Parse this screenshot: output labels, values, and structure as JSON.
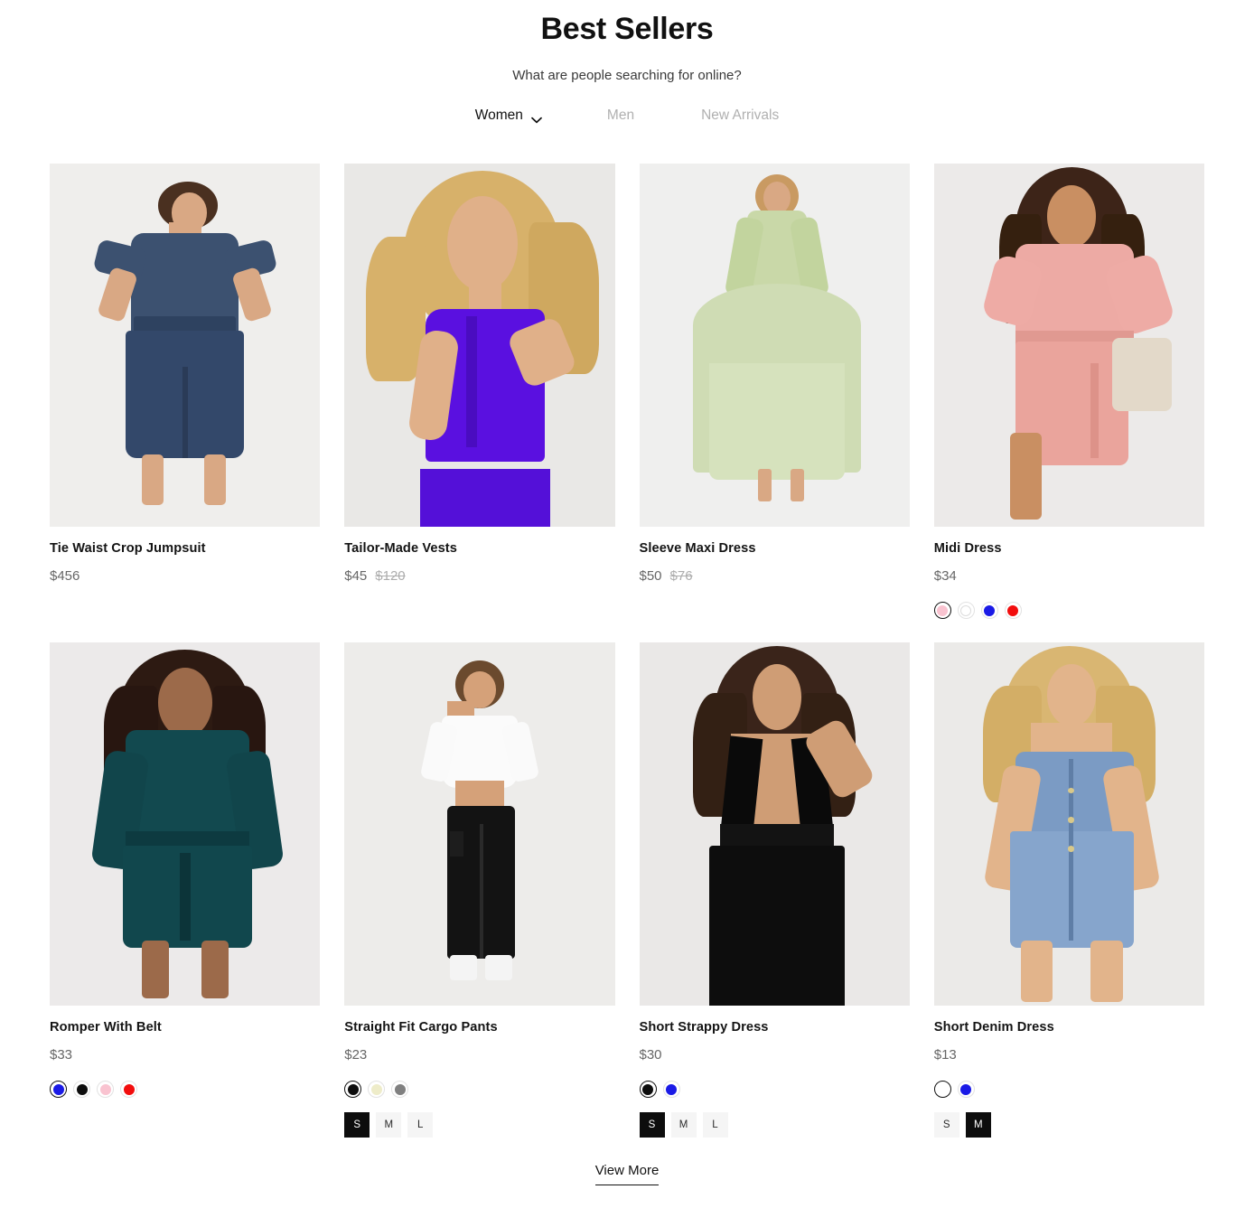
{
  "header": {
    "title": "Best Sellers",
    "subtitle": "What are people searching for online?",
    "tabs": [
      {
        "label": "Women",
        "active": true,
        "icon": "chevron-down-icon"
      },
      {
        "label": "Men",
        "active": false
      },
      {
        "label": "New Arrivals",
        "active": false
      }
    ]
  },
  "products": [
    {
      "title": "Tie Waist Crop Jumpsuit",
      "price": "$456",
      "price_old": "",
      "colors": [],
      "sizes": []
    },
    {
      "title": "Tailor-Made Vests",
      "price": "$45",
      "price_old": "$120",
      "colors": [],
      "sizes": []
    },
    {
      "title": "Sleeve Maxi Dress",
      "price": "$50",
      "price_old": "$76",
      "colors": [],
      "sizes": []
    },
    {
      "title": "Midi Dress",
      "price": "$34",
      "price_old": "",
      "colors": [
        {
          "name": "pink",
          "hex": "#f9c3d0",
          "selected": true
        },
        {
          "name": "white",
          "hex": "#ffffff",
          "selected": false
        },
        {
          "name": "blue",
          "hex": "#1a1ae6",
          "selected": false
        },
        {
          "name": "red",
          "hex": "#f20d0d",
          "selected": false
        }
      ],
      "sizes": []
    },
    {
      "title": "Romper With Belt",
      "price": "$33",
      "price_old": "",
      "colors": [
        {
          "name": "blue",
          "hex": "#1a1ae6",
          "selected": true
        },
        {
          "name": "black",
          "hex": "#0d0d0d",
          "selected": false
        },
        {
          "name": "pink",
          "hex": "#f9c3d0",
          "selected": false
        },
        {
          "name": "red",
          "hex": "#f20d0d",
          "selected": false
        }
      ],
      "sizes": []
    },
    {
      "title": "Straight Fit Cargo Pants",
      "price": "$23",
      "price_old": "",
      "colors": [
        {
          "name": "black",
          "hex": "#0d0d0d",
          "selected": true
        },
        {
          "name": "cream",
          "hex": "#eeecc9",
          "selected": false
        },
        {
          "name": "gray",
          "hex": "#808080",
          "selected": false
        }
      ],
      "sizes": [
        {
          "label": "S",
          "selected": true
        },
        {
          "label": "M",
          "selected": false
        },
        {
          "label": "L",
          "selected": false
        }
      ]
    },
    {
      "title": "Short Strappy Dress",
      "price": "$30",
      "price_old": "",
      "colors": [
        {
          "name": "black",
          "hex": "#0d0d0d",
          "selected": true
        },
        {
          "name": "blue",
          "hex": "#1a1ae6",
          "selected": false
        }
      ],
      "sizes": [
        {
          "label": "S",
          "selected": true
        },
        {
          "label": "M",
          "selected": false
        },
        {
          "label": "L",
          "selected": false
        }
      ]
    },
    {
      "title": "Short Denim Dress",
      "price": "$13",
      "price_old": "",
      "colors": [
        {
          "name": "white",
          "hex": "#ffffff",
          "selected": true
        },
        {
          "name": "blue",
          "hex": "#1a1ae6",
          "selected": false
        }
      ],
      "sizes": [
        {
          "label": "S",
          "selected": false
        },
        {
          "label": "M",
          "selected": true
        }
      ]
    }
  ],
  "footer": {
    "view_more_label": "View More"
  }
}
